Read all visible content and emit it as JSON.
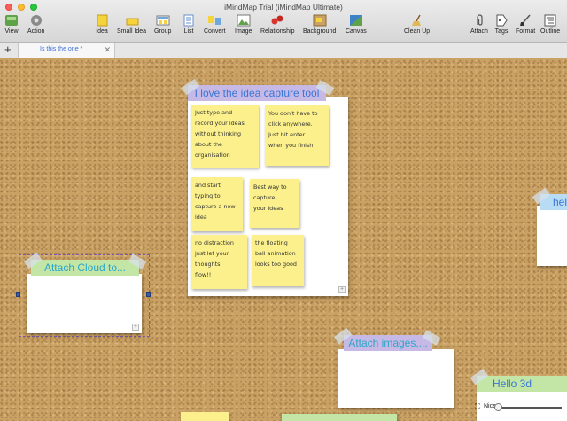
{
  "window": {
    "title": "iMindMap Trial (iMindMap Ultimate)"
  },
  "toolbar": {
    "view": "View",
    "action": "Action",
    "idea": "Idea",
    "small_idea": "Small Idea",
    "group": "Group",
    "list": "List",
    "convert": "Convert",
    "image": "Image",
    "relationship": "Relationship",
    "background": "Background",
    "canvas": "Canvas",
    "clean_up": "Clean Up",
    "attach": "Attach",
    "tags": "Tags",
    "format": "Format",
    "outline": "Outline"
  },
  "tabs": [
    {
      "label": "Is this the one *"
    }
  ],
  "main_card": {
    "title": "I love the idea capture tool",
    "notes": [
      "Just type and\nrecord your ideas\nwithout thinking\nabout the\norganisation",
      "You don't have to\nclick anywhere.\nJust hit enter\nwhen you finish",
      "and start\ntyping to\ncapture a new\nidea",
      "Best way to\ncapture\nyour ideas",
      "no distraction\njust let your\nthoughts\nflow!!",
      "the floating\nball animation\nlooks too good"
    ]
  },
  "cards": {
    "attach_cloud": "Attach Cloud to...",
    "attach_images": "Attach images,...",
    "hello_3d": "Hello 3d",
    "right_partial": "hel"
  },
  "zoom": {
    "label": "Nice"
  },
  "colors": {
    "sticky": "#fbf08c",
    "banner_purple": "#c7b9e6",
    "banner_green": "#c3e6a7",
    "banner_blue": "#b9dcf5",
    "banner_text_blue": "#3976d6",
    "banner_text_teal": "#2aa6c8",
    "cork": "#c9a164"
  }
}
